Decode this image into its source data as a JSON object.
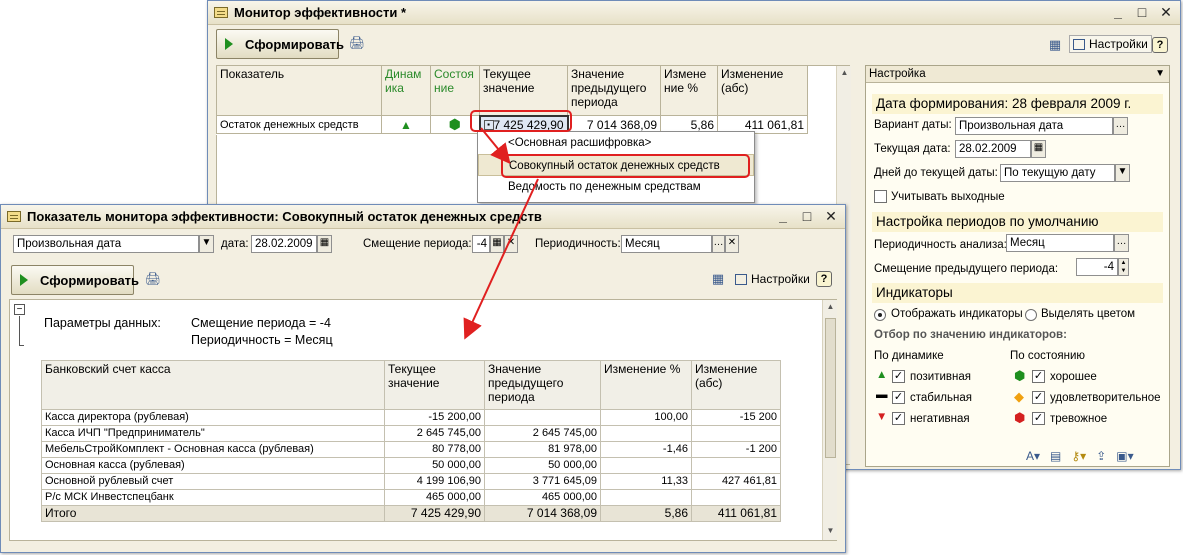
{
  "monitor": {
    "title": "Монитор эффективности *",
    "generate_label": "Сформировать",
    "settings_label": "Настройки",
    "help": "?",
    "columns": [
      "Показатель",
      "Динамика",
      "Состояние",
      "Текущее значение",
      "Значение предыдущего периода",
      "Изменение %",
      "Изменение (абс)"
    ],
    "col_dynamics_display": "Динам ика",
    "col_state_display": "Состоя ние",
    "col_change_pct_display": "Измене ние %",
    "row": {
      "name": "Остаток денежных средств",
      "dynamics": "positive",
      "state": "good",
      "current": "7 425 429,90",
      "previous": "7 014 368,09",
      "change_pct": "5,86",
      "change_abs": "411 061,81"
    },
    "context_menu": [
      "<Основная расшифровка>",
      "Совокупный остаток денежных средств",
      "Ведомость по денежным средствам"
    ]
  },
  "settings_panel": {
    "header": "Настройка",
    "date_heading": "Дата формирования: 28 февраля 2009 г.",
    "variant_label": "Вариант даты:",
    "variant_value": "Произвольная дата",
    "current_date_label": "Текущая дата:",
    "current_date_value": "28.02.2009",
    "days_label": "Дней до текущей даты:",
    "days_value": "По текущую дату",
    "weekends_label": "Учитывать выходные",
    "periods_heading": "Настройка периодов по умолчанию",
    "periodicity_label": "Периодичность анализа:",
    "periodicity_value": "Месяц",
    "shift_label": "Смещение предыдущего периода:",
    "shift_value": "-4",
    "indicators_heading": "Индикаторы",
    "show_indicators": "Отображать индикаторы",
    "highlight_color": "Выделять цветом",
    "filter_heading": "Отбор по значению индикаторов:",
    "by_dynamics": "По динамике",
    "by_state": "По состоянию",
    "dyn_items": [
      "позитивная",
      "стабильная",
      "негативная"
    ],
    "state_items": [
      "хорошее",
      "удовлетворительное",
      "тревожное"
    ],
    "colors": {
      "positive": "#1f8f1f",
      "good": "#1f8f1f",
      "ok": "#f0a010",
      "bad": "#d42020"
    }
  },
  "detail": {
    "title": "Показатель монитора эффективности: Совокупный остаток денежных средств",
    "variant_value": "Произвольная дата",
    "date_label": "дата:",
    "date_value": "28.02.2009",
    "shift_label": "Смещение периода:",
    "shift_value": "-4",
    "periodicity_label": "Периодичность:",
    "periodicity_value": "Месяц",
    "generate_label": "Сформировать",
    "settings_label": "Настройки",
    "help": "?",
    "params_label": "Параметры данных:",
    "param1": "Смещение периода = -4",
    "param2": "Периодичность = Месяц",
    "columns": [
      "Банковский счет касса",
      "Текущее значение",
      "Значение предыдущего периода",
      "Изменение %",
      "Изменение (абс)"
    ],
    "rows": [
      [
        "Касса директора (рублевая)",
        "-15 200,00",
        "",
        "100,00",
        "-15 200"
      ],
      [
        "Касса ИЧП \"Предприниматель\"",
        "2 645 745,00",
        "2 645 745,00",
        "",
        ""
      ],
      [
        "МебельСтройКомплект - Основная касса (рублевая)",
        "80 778,00",
        "81 978,00",
        "-1,46",
        "-1 200"
      ],
      [
        "Основная касса (рублевая)",
        "50 000,00",
        "50 000,00",
        "",
        ""
      ],
      [
        "Основной рублевый счет",
        "4 199 106,90",
        "3 771 645,09",
        "11,33",
        "427 461,81"
      ],
      [
        "Р/с МСК Инвестспецбанк",
        "465 000,00",
        "465 000,00",
        "",
        ""
      ]
    ],
    "total": [
      "Итого",
      "7 425 429,90",
      "7 014 368,09",
      "5,86",
      "411 061,81"
    ]
  }
}
